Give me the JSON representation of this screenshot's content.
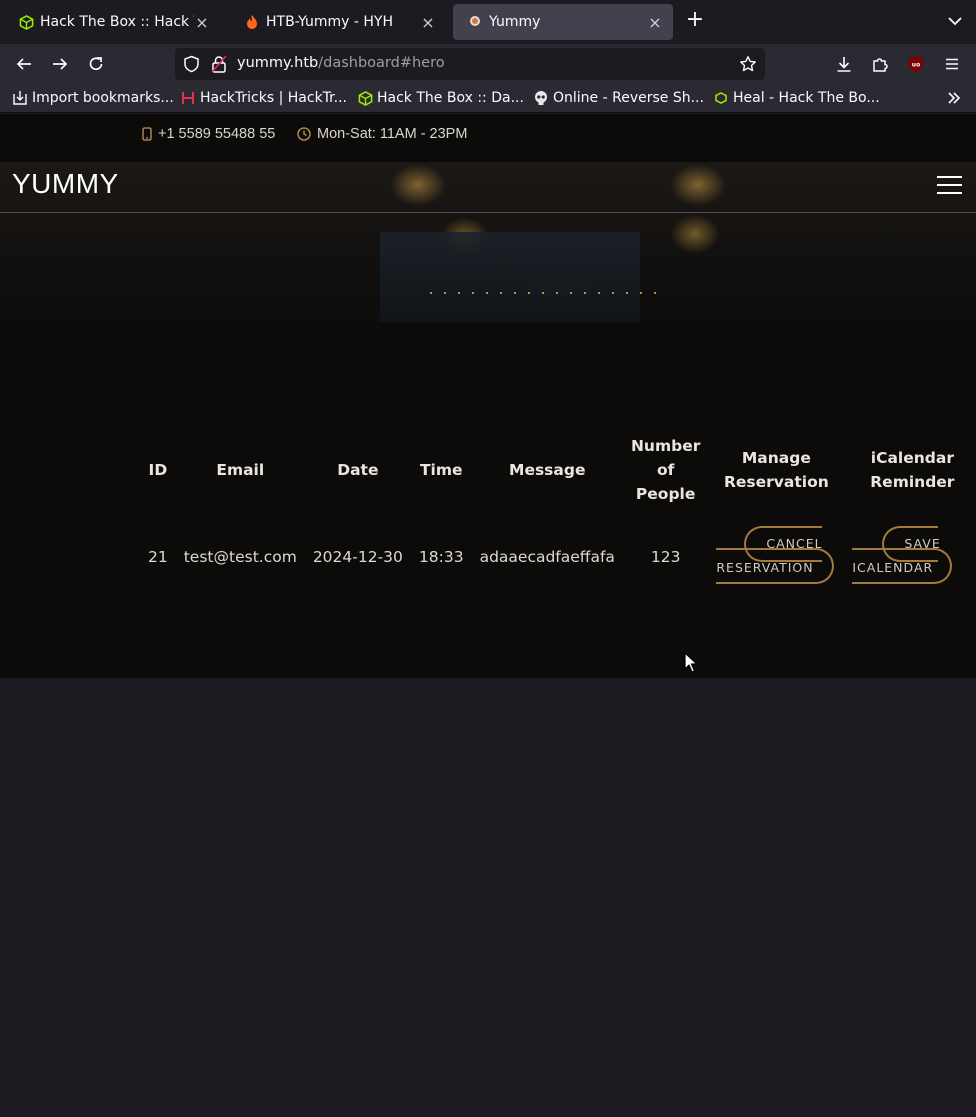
{
  "browser": {
    "tabs": [
      {
        "title": "Hack The Box :: Hack The Box",
        "icon": "htb-cube-icon",
        "active": false
      },
      {
        "title": "HTB-Yummy - HYH",
        "icon": "flame-icon",
        "active": false
      },
      {
        "title": "Yummy",
        "icon": "chef-hat-icon",
        "active": true
      }
    ],
    "address": {
      "host": "yummy.htb",
      "path": "/dashboard#hero"
    },
    "bookmarks": [
      {
        "label": "Import bookmarks...",
        "icon": "import-icon"
      },
      {
        "label": "HackTricks | HackTr...",
        "icon": "hacktricks-icon"
      },
      {
        "label": "Hack The Box :: Da...",
        "icon": "htb-cube-icon"
      },
      {
        "label": "Online - Reverse Sh...",
        "icon": "skull-icon"
      },
      {
        "label": "Heal - Hack The Bo...",
        "icon": "htb-small-icon"
      }
    ]
  },
  "topbar": {
    "phone": "+1 5589 55488 55",
    "hours": "Mon-Sat: 11AM - 23PM"
  },
  "header": {
    "logo": "YUMMY"
  },
  "table": {
    "headers": {
      "id": "ID",
      "email": "Email",
      "date": "Date",
      "time": "Time",
      "message": "Message",
      "people_1": "Number",
      "people_2": "of",
      "people_3": "People",
      "manage_1": "Manage",
      "manage_2": "Reservation",
      "ical_1": "iCalendar",
      "ical_2": "Reminder"
    },
    "rows": [
      {
        "id": "21",
        "email": "test@test.com",
        "date": "2024-12-30",
        "time": "18:33",
        "message": "adaaecadfaeffafa",
        "people": "123",
        "cancel_1": "CANCEL",
        "cancel_2": "RESERVATION",
        "save_1": "SAVE",
        "save_2": "ICALENDAR"
      }
    ]
  },
  "colors": {
    "accent": "#a27b3e",
    "section_bg": "#0d0b0a",
    "browser_bg": "#1c1b22"
  }
}
